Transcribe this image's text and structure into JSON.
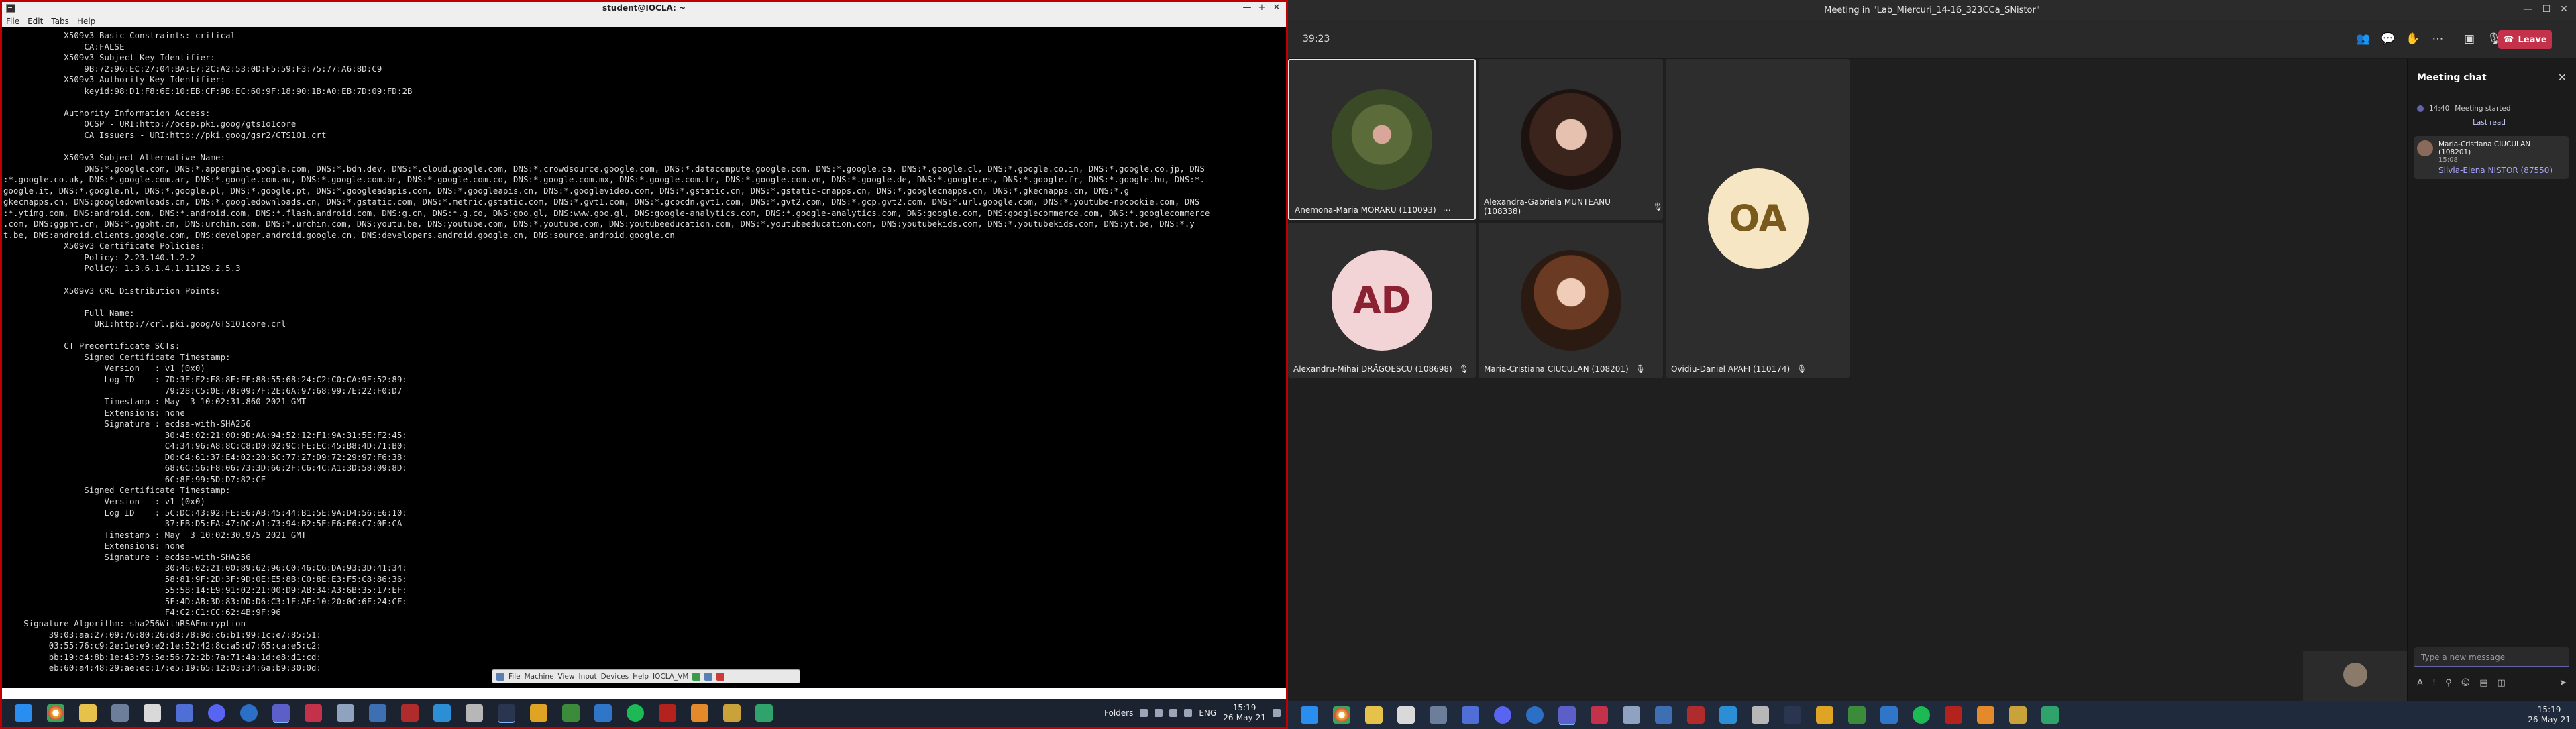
{
  "terminal": {
    "title": "student@IOCLA: ~",
    "menu": [
      "File",
      "Edit",
      "Tabs",
      "Help"
    ],
    "lines": [
      "            X509v3 Basic Constraints: critical",
      "                CA:FALSE",
      "            X509v3 Subject Key Identifier:",
      "                9B:72:96:EC:27:04:BA:E7:2C:A2:53:0D:F5:59:F3:75:77:A6:8D:C9",
      "            X509v3 Authority Key Identifier:",
      "                keyid:98:D1:F8:6E:10:EB:CF:9B:EC:60:9F:18:90:1B:A0:EB:7D:09:FD:2B",
      "",
      "            Authority Information Access:",
      "                OCSP - URI:http://ocsp.pki.goog/gts1o1core",
      "                CA Issuers - URI:http://pki.goog/gsr2/GTS1O1.crt",
      "",
      "            X509v3 Subject Alternative Name:",
      "                DNS:*.google.com, DNS:*.appengine.google.com, DNS:*.bdn.dev, DNS:*.cloud.google.com, DNS:*.crowdsource.google.com, DNS:*.datacompute.google.com, DNS:*.google.ca, DNS:*.google.cl, DNS:*.google.co.in, DNS:*.google.co.jp, DNS",
      ":*.google.co.uk, DNS:*.google.com.ar, DNS:*.google.com.au, DNS:*.google.com.br, DNS:*.google.com.co, DNS:*.google.com.mx, DNS:*.google.com.tr, DNS:*.google.com.vn, DNS:*.google.de, DNS:*.google.es, DNS:*.google.fr, DNS:*.google.hu, DNS:*.",
      "google.it, DNS:*.google.nl, DNS:*.google.pl, DNS:*.google.pt, DNS:*.googleadapis.com, DNS:*.googleapis.cn, DNS:*.googlevideo.com, DNS:*.gstatic.cn, DNS:*.gstatic-cnapps.cn, DNS:*.googlecnapps.cn, DNS:*.gkecnapps.cn, DNS:*.g",
      "gkecnapps.cn, DNS:googledownloads.cn, DNS:*.googledownloads.cn, DNS:*.gstatic.com, DNS:*.metric.gstatic.com, DNS:*.gvt1.com, DNS:*.gcpcdn.gvt1.com, DNS:*.gvt2.com, DNS:*.gcp.gvt2.com, DNS:*.url.google.com, DNS:*.youtube-nocookie.com, DNS",
      ":*.ytimg.com, DNS:android.com, DNS:*.android.com, DNS:*.flash.android.com, DNS:g.cn, DNS:*.g.co, DNS:goo.gl, DNS:www.goo.gl, DNS:google-analytics.com, DNS:*.google-analytics.com, DNS:google.com, DNS:googlecommerce.com, DNS:*.googlecommerce",
      ".com, DNS:ggpht.cn, DNS:*.ggpht.cn, DNS:urchin.com, DNS:*.urchin.com, DNS:youtu.be, DNS:youtube.com, DNS:*.youtube.com, DNS:youtubeeducation.com, DNS:*.youtubeeducation.com, DNS:youtubekids.com, DNS:*.youtubekids.com, DNS:yt.be, DNS:*.y",
      "t.be, DNS:android.clients.google.com, DNS:developer.android.google.cn, DNS:developers.android.google.cn, DNS:source.android.google.cn",
      "            X509v3 Certificate Policies:",
      "                Policy: 2.23.140.1.2.2",
      "                Policy: 1.3.6.1.4.1.11129.2.5.3",
      "",
      "            X509v3 CRL Distribution Points:",
      "",
      "                Full Name:",
      "                  URI:http://crl.pki.goog/GTS1O1core.crl",
      "",
      "            CT Precertificate SCTs:",
      "                Signed Certificate Timestamp:",
      "                    Version   : v1 (0x0)",
      "                    Log ID    : 7D:3E:F2:F8:8F:FF:88:55:68:24:C2:C0:CA:9E:52:89:",
      "                                79:28:C5:0E:78:09:7F:2E:6A:97:68:99:7E:22:F0:D7",
      "                    Timestamp : May  3 10:02:31.860 2021 GMT",
      "                    Extensions: none",
      "                    Signature : ecdsa-with-SHA256",
      "                                30:45:02:21:00:9D:AA:94:52:12:F1:9A:31:5E:F2:45:",
      "                                C4:34:96:A8:8C:C8:D0:02:9C:FE:EC:45:B8:4D:71:B0:",
      "                                D0:C4:61:37:E4:02:20:5C:77:27:D9:72:29:97:F6:38:",
      "                                68:6C:56:F8:06:73:3D:66:2F:C6:4C:A1:3D:58:09:8D:",
      "                                6C:8F:99:5D:D7:82:CE",
      "                Signed Certificate Timestamp:",
      "                    Version   : v1 (0x0)",
      "                    Log ID    : 5C:DC:43:92:FE:E6:AB:45:44:B1:5E:9A:D4:56:E6:10:",
      "                                37:FB:D5:FA:47:DC:A1:73:94:B2:5E:E6:F6:C7:0E:CA",
      "                    Timestamp : May  3 10:02:30.975 2021 GMT",
      "                    Extensions: none",
      "                    Signature : ecdsa-with-SHA256",
      "                                30:46:02:21:00:89:62:96:C0:46:C6:DA:93:3D:41:34:",
      "                                58:81:9F:2D:3F:9D:0E:E5:8B:C0:8E:E3:F5:C8:86:36:",
      "                                55:58:14:E9:91:02:21:00:D9:AB:34:A3:6B:35:17:EF:",
      "                                5F:4D:AB:3D:83:DD:D6:C3:1F:AE:10:20:0C:6F:24:CF:",
      "                                F4:C2:C1:CC:62:4B:9F:96",
      "    Signature Algorithm: sha256WithRSAEncryption",
      "         39:03:aa:27:09:76:80:26:d8:78:9d:c6:b1:99:1c:e7:85:51:",
      "         03:55:76:c9:2e:1e:e9:e2:1e:52:42:8c:a5:d7:65:ca:e5:c2:",
      "         bb:19:d4:8b:1e:43:75:5e:56:72:2b:7a:71:4a:1d:e8:d1:cd:",
      "         eb:60:a4:48:29:ae:ec:17:e5:19:65:12:03:34:6a:b9:30:0d:"
    ],
    "vbox_menu": [
      "File",
      "Machine",
      "View",
      "Input",
      "Devices",
      "Help",
      "IOCLA_VM"
    ]
  },
  "left_taskbar": {
    "tray_lang": "ENG",
    "folders_label": "Folders",
    "time": "15:19",
    "date": "26-May-21"
  },
  "teams": {
    "window_title": "Meeting in \"Lab_Miercuri_14-16_323CCa_SNistor\"",
    "timer": "39:23",
    "leave_label": "Leave",
    "participants": [
      {
        "name": "Anemona-Maria MORARU (110093)",
        "type": "photo",
        "selected": true
      },
      {
        "name": "Alexandra-Gabriela MUNTEANU (108338)",
        "type": "photo"
      },
      {
        "name": "Ovidiu-Daniel APAFI (110174)",
        "type": "initials",
        "initials": "OA",
        "bg": "#f6e6c4",
        "fg": "#7a5a1c"
      },
      {
        "name": "Alexandru-Mihai DRĂGOESCU (108698)",
        "type": "initials",
        "initials": "AD",
        "bg": "#f2d4d7",
        "fg": "#8a2232"
      },
      {
        "name": "Maria-Cristiana CIUCULAN (108201)",
        "type": "photo"
      }
    ],
    "chat": {
      "title": "Meeting chat",
      "event_time": "14:40",
      "event_text": "Meeting started",
      "last_read": "Last read",
      "message_author": "Maria-Cristiana CIUCULAN (108201)",
      "message_time": "15:08",
      "message_mention": "Silvia-Elena NISTOR (87550)",
      "compose_placeholder": "Type a new message"
    }
  },
  "right_taskbar": {
    "time": "15:19",
    "date": "26-May-21"
  }
}
